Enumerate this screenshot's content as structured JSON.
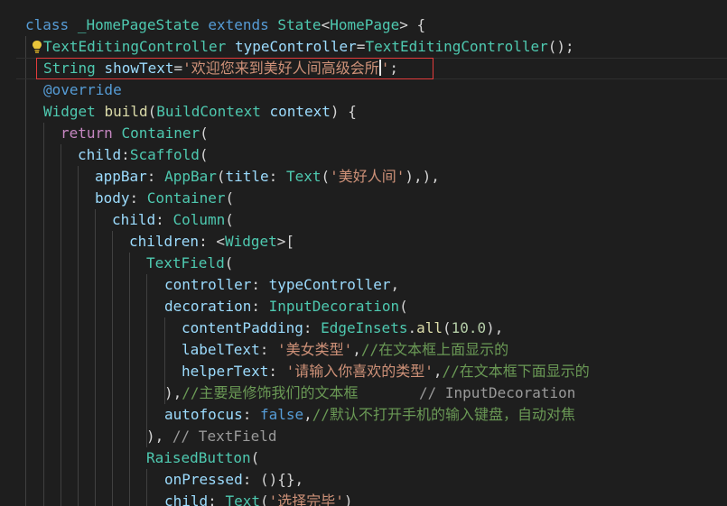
{
  "editor": {
    "colors": {
      "background": "#1e1e1e",
      "keyword": "#569cd6",
      "control_keyword": "#c586c0",
      "class_name": "#4ec9b0",
      "function": "#dcdcaa",
      "variable": "#9cdcfe",
      "string": "#ce9178",
      "number": "#b5cea8",
      "comment": "#6a9955",
      "closing_label": "#9a9a9a",
      "highlight_box": "#e23c3c"
    },
    "lightbulb_icon": "lightbulb-icon",
    "lines": [
      {
        "tokens": [
          {
            "t": "class",
            "c": "kw"
          },
          {
            "t": " ",
            "c": "pl"
          },
          {
            "t": "_HomePageState",
            "c": "cls"
          },
          {
            "t": " ",
            "c": "pl"
          },
          {
            "t": "extends",
            "c": "kw"
          },
          {
            "t": " ",
            "c": "pl"
          },
          {
            "t": "State",
            "c": "cls"
          },
          {
            "t": "<",
            "c": "pl"
          },
          {
            "t": "HomePage",
            "c": "cls"
          },
          {
            "t": "> {",
            "c": "pl"
          }
        ]
      },
      {
        "tokens": [
          {
            "t": "TextEditingController",
            "c": "cls"
          },
          {
            "t": " ",
            "c": "pl"
          },
          {
            "t": "typeController",
            "c": "var"
          },
          {
            "t": "=",
            "c": "pl"
          },
          {
            "t": "TextEditingController",
            "c": "cls"
          },
          {
            "t": "();",
            "c": "pl"
          }
        ]
      },
      {
        "tokens": [
          {
            "t": "String",
            "c": "cls"
          },
          {
            "t": " ",
            "c": "pl"
          },
          {
            "t": "showText",
            "c": "var"
          },
          {
            "t": "=",
            "c": "pl"
          },
          {
            "t": "'欢迎您来到美好人间高级会所",
            "c": "str"
          },
          {
            "t": "'",
            "c": "str"
          },
          {
            "t": ";",
            "c": "pl"
          }
        ]
      },
      {
        "tokens": [
          {
            "t": "@override",
            "c": "kw"
          }
        ]
      },
      {
        "tokens": [
          {
            "t": "Widget",
            "c": "cls"
          },
          {
            "t": " ",
            "c": "pl"
          },
          {
            "t": "build",
            "c": "fn"
          },
          {
            "t": "(",
            "c": "pl"
          },
          {
            "t": "BuildContext",
            "c": "cls"
          },
          {
            "t": " ",
            "c": "pl"
          },
          {
            "t": "context",
            "c": "var"
          },
          {
            "t": ") {",
            "c": "pl"
          }
        ]
      },
      {
        "tokens": [
          {
            "t": "return",
            "c": "ctl"
          },
          {
            "t": " ",
            "c": "pl"
          },
          {
            "t": "Container",
            "c": "cls"
          },
          {
            "t": "(",
            "c": "pl"
          }
        ]
      },
      {
        "tokens": [
          {
            "t": "child",
            "c": "var"
          },
          {
            "t": ":",
            "c": "pl"
          },
          {
            "t": "Scaffold",
            "c": "cls"
          },
          {
            "t": "(",
            "c": "pl"
          }
        ]
      },
      {
        "tokens": [
          {
            "t": "appBar",
            "c": "var"
          },
          {
            "t": ": ",
            "c": "pl"
          },
          {
            "t": "AppBar",
            "c": "cls"
          },
          {
            "t": "(",
            "c": "pl"
          },
          {
            "t": "title",
            "c": "var"
          },
          {
            "t": ": ",
            "c": "pl"
          },
          {
            "t": "Text",
            "c": "cls"
          },
          {
            "t": "(",
            "c": "pl"
          },
          {
            "t": "'美好人间'",
            "c": "str"
          },
          {
            "t": "),),",
            "c": "pl"
          }
        ]
      },
      {
        "tokens": [
          {
            "t": "body",
            "c": "var"
          },
          {
            "t": ": ",
            "c": "pl"
          },
          {
            "t": "Container",
            "c": "cls"
          },
          {
            "t": "(",
            "c": "pl"
          }
        ]
      },
      {
        "tokens": [
          {
            "t": "child",
            "c": "var"
          },
          {
            "t": ": ",
            "c": "pl"
          },
          {
            "t": "Column",
            "c": "cls"
          },
          {
            "t": "(",
            "c": "pl"
          }
        ]
      },
      {
        "tokens": [
          {
            "t": "children",
            "c": "var"
          },
          {
            "t": ": <",
            "c": "pl"
          },
          {
            "t": "Widget",
            "c": "cls"
          },
          {
            "t": ">[",
            "c": "pl"
          }
        ]
      },
      {
        "tokens": [
          {
            "t": "TextField",
            "c": "cls"
          },
          {
            "t": "(",
            "c": "pl"
          }
        ]
      },
      {
        "tokens": [
          {
            "t": "controller",
            "c": "var"
          },
          {
            "t": ": ",
            "c": "pl"
          },
          {
            "t": "typeController",
            "c": "var"
          },
          {
            "t": ",",
            "c": "pl"
          }
        ]
      },
      {
        "tokens": [
          {
            "t": "decoration",
            "c": "var"
          },
          {
            "t": ": ",
            "c": "pl"
          },
          {
            "t": "InputDecoration",
            "c": "cls"
          },
          {
            "t": "(",
            "c": "pl"
          }
        ]
      },
      {
        "tokens": [
          {
            "t": "contentPadding",
            "c": "var"
          },
          {
            "t": ": ",
            "c": "pl"
          },
          {
            "t": "EdgeInsets",
            "c": "cls"
          },
          {
            "t": ".",
            "c": "pl"
          },
          {
            "t": "all",
            "c": "fn"
          },
          {
            "t": "(",
            "c": "pl"
          },
          {
            "t": "10.0",
            "c": "num"
          },
          {
            "t": "),",
            "c": "pl"
          }
        ]
      },
      {
        "tokens": [
          {
            "t": "labelText",
            "c": "var"
          },
          {
            "t": ": ",
            "c": "pl"
          },
          {
            "t": "'美女类型'",
            "c": "str"
          },
          {
            "t": ",",
            "c": "pl"
          },
          {
            "t": "//在文本框上面显示的",
            "c": "cmt"
          }
        ]
      },
      {
        "tokens": [
          {
            "t": "helperText",
            "c": "var"
          },
          {
            "t": ": ",
            "c": "pl"
          },
          {
            "t": "'请输入你喜欢的类型'",
            "c": "str"
          },
          {
            "t": ",",
            "c": "pl"
          },
          {
            "t": "//在文本框下面显示的",
            "c": "cmt"
          }
        ]
      },
      {
        "tokens": [
          {
            "t": "),",
            "c": "pl"
          },
          {
            "t": "//主要是修饰我们的文本框",
            "c": "cmt"
          },
          {
            "t": "       // InputDecoration",
            "c": "hint"
          }
        ]
      },
      {
        "tokens": [
          {
            "t": "autofocus",
            "c": "var"
          },
          {
            "t": ": ",
            "c": "pl"
          },
          {
            "t": "false",
            "c": "kw"
          },
          {
            "t": ",",
            "c": "pl"
          },
          {
            "t": "//默认不打开手机的输入键盘，自动对焦",
            "c": "cmt"
          }
        ]
      },
      {
        "tokens": [
          {
            "t": "), ",
            "c": "pl"
          },
          {
            "t": "// TextField",
            "c": "hint"
          }
        ]
      },
      {
        "tokens": [
          {
            "t": "RaisedButton",
            "c": "cls"
          },
          {
            "t": "(",
            "c": "pl"
          }
        ]
      },
      {
        "tokens": [
          {
            "t": "onPressed",
            "c": "var"
          },
          {
            "t": ": (){},",
            "c": "pl"
          }
        ]
      },
      {
        "tokens": [
          {
            "t": "child",
            "c": "var"
          },
          {
            "t": ": ",
            "c": "pl"
          },
          {
            "t": "Text",
            "c": "cls"
          },
          {
            "t": "(",
            "c": "pl"
          },
          {
            "t": "'选择完毕'",
            "c": "str"
          },
          {
            "t": ")",
            "c": "pl"
          }
        ]
      }
    ]
  }
}
